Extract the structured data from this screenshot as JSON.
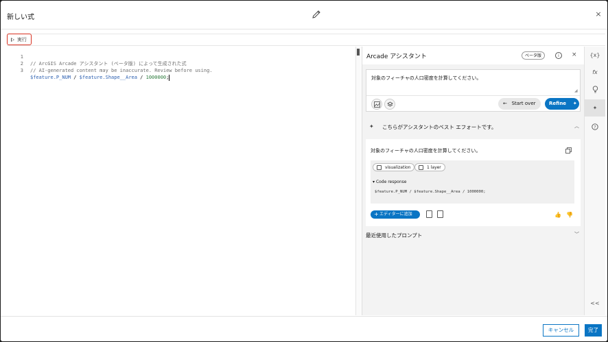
{
  "dialog": {
    "title": "新しい式",
    "close_glyph": "×"
  },
  "toolbar": {
    "run_label": "実行"
  },
  "editor": {
    "lines": [
      {
        "num": "1",
        "text": "// ArcGIS Arcade アシスタント (ベータ版) によって生成された式"
      },
      {
        "num": "2",
        "text": "// AI-generated content may be inaccurate. Review before using."
      },
      {
        "num": "3",
        "var1": "$feature.P_NUM",
        "op1": " / ",
        "var2": "$feature.Shape__Area",
        "op2": " / ",
        "number": "1000000",
        "end": ";"
      }
    ]
  },
  "assistant": {
    "title": "Arcade アシスタント",
    "beta_badge": "ベータ版",
    "close_glyph": "×",
    "prompt_text": "対象のフィーチャの人口密度を計算してください。",
    "start_over_label": "Start over",
    "refine_label": "Refine",
    "best_effort_text": "こちらがアシスタントのベスト エフォートです。",
    "response": {
      "title": "対象のフィーチャの人口密度を計算してください。",
      "chips": [
        "visualization",
        "1 layer"
      ],
      "code_response_label": "Code response",
      "code_text": "$feature.P_NUM / $feature.Shape__Area / 1000000;",
      "add_to_editor_label": "エディターに追加"
    },
    "recent_prompts_label": "最近使用したプロンプト"
  },
  "rail": {
    "items": [
      "{x}",
      "fx",
      "lightbulb-icon",
      "sparkle-icon",
      "help-icon"
    ],
    "collapse_glyph": "<<"
  },
  "footer": {
    "cancel_label": "キャンセル",
    "done_label": "完了"
  },
  "colors": {
    "accent": "#0a75c4",
    "run_highlight": "#d83020"
  }
}
